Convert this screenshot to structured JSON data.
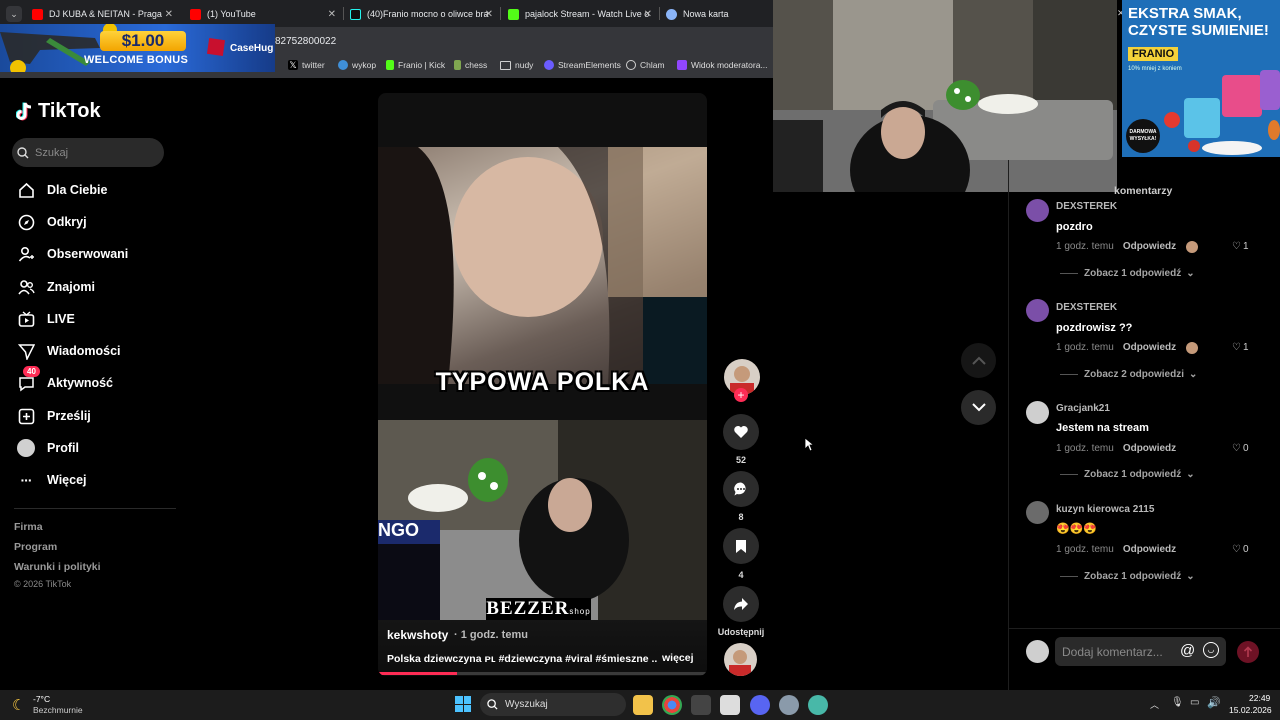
{
  "browser": {
    "tabs": [
      {
        "title": "DJ KUBA & NEITAN - Praga",
        "color": "#ff0000"
      },
      {
        "title": "(1) YouTube",
        "color": "#ff0000"
      },
      {
        "title": "(40)Franio mocno o oliwce bra",
        "color": "#25f4ee"
      },
      {
        "title": "pajalock Stream - Watch Live o",
        "color": "#53fc18"
      },
      {
        "title": "Nowa karta",
        "color": "#8ab4f8"
      }
    ],
    "address_fragment": "82752800022",
    "bookmarks": [
      {
        "label": "twitter",
        "color": "#ffffff"
      },
      {
        "label": "wykop",
        "color": "#3f8fd8"
      },
      {
        "label": "Franio | Kick",
        "color": "#53fc18"
      },
      {
        "label": "chess",
        "color": "#7fa650"
      },
      {
        "label": "nudy",
        "color": "#cfcfcf"
      },
      {
        "label": "StreamElements",
        "color": "#6b5cff"
      },
      {
        "label": "Chlam",
        "color": "#cfcfcf"
      },
      {
        "label": "Widok moderatora...",
        "color": "#9146ff"
      }
    ]
  },
  "ad": {
    "amount": "$1.00",
    "text": "WELCOME BONUS",
    "brand": "CaseHug"
  },
  "tiktok": {
    "logo": "TikTok",
    "search_placeholder": "Szukaj",
    "nav": [
      {
        "label": "Dla Ciebie",
        "icon": "home-icon"
      },
      {
        "label": "Odkryj",
        "icon": "compass-icon"
      },
      {
        "label": "Obserwowani",
        "icon": "following-icon"
      },
      {
        "label": "Znajomi",
        "icon": "friends-icon"
      },
      {
        "label": "LIVE",
        "icon": "live-icon"
      },
      {
        "label": "Wiadomości",
        "icon": "messages-icon"
      },
      {
        "label": "Aktywność",
        "icon": "activity-icon",
        "badge": "40"
      },
      {
        "label": "Prześlij",
        "icon": "upload-icon"
      },
      {
        "label": "Profil",
        "icon": "profile-icon"
      },
      {
        "label": "Więcej",
        "icon": "more-icon"
      }
    ],
    "footer": [
      "Firma",
      "Program",
      "Warunki i polityki",
      "© 2026 TikTok"
    ]
  },
  "video": {
    "caption_overlay": "TYPOWA POLKA",
    "watermark": "BEZZER",
    "watermark_sub": "shop",
    "author": "kekwshoty",
    "time": "· 1 godz. temu",
    "description": "Polska dziewczyna ᴘʟ #dziewczyna #viral #śmieszne ...",
    "more": "więcej",
    "progress": 0.24,
    "likes": "52",
    "comments": "8",
    "saves": "4",
    "share_label": "Udostępnij",
    "side_text": "NGO"
  },
  "promo": {
    "headline_1": "EKSTRA SMAK,",
    "headline_2": "CZYSTE SUMIENIE!",
    "brand": "FRANIO",
    "sub": "10% mniej z koniem",
    "badge": "DARMOWA WYSYŁKA!"
  },
  "comments": {
    "header": "komentarzy",
    "items": [
      {
        "user": "DEXSTEREK",
        "text": "pozdro",
        "time": "1 godz. temu",
        "reply": "Odpowiedz",
        "likes": "1",
        "replies": "Zobacz 1 odpowiedź",
        "avatar": "#7b4fa8"
      },
      {
        "user": "DEXSTEREK",
        "text": "pozdrowisz ??",
        "time": "1 godz. temu",
        "reply": "Odpowiedz",
        "likes": "1",
        "replies": "Zobacz 2 odpowiedzi",
        "avatar": "#7b4fa8"
      },
      {
        "user": "Gracjank21",
        "text": "Jestem na stream",
        "time": "1 godz. temu",
        "reply": "Odpowiedz",
        "likes": "0",
        "replies": "Zobacz 1 odpowiedź",
        "avatar": "#cfcfcf"
      },
      {
        "user": "kuzyn kierowca 2115",
        "text": "😍😍😍",
        "time": "1 godz. temu",
        "reply": "Odpowiedz",
        "likes": "0",
        "replies": "Zobacz 1 odpowiedź",
        "avatar": "#6b6b6b"
      }
    ],
    "input_placeholder": "Dodaj komentarz..."
  },
  "taskbar": {
    "weather_temp": "-7°C",
    "weather_desc": "Bezchmurnie",
    "search": "Wyszukaj",
    "time": "22:49",
    "date": "15.02.2026"
  }
}
